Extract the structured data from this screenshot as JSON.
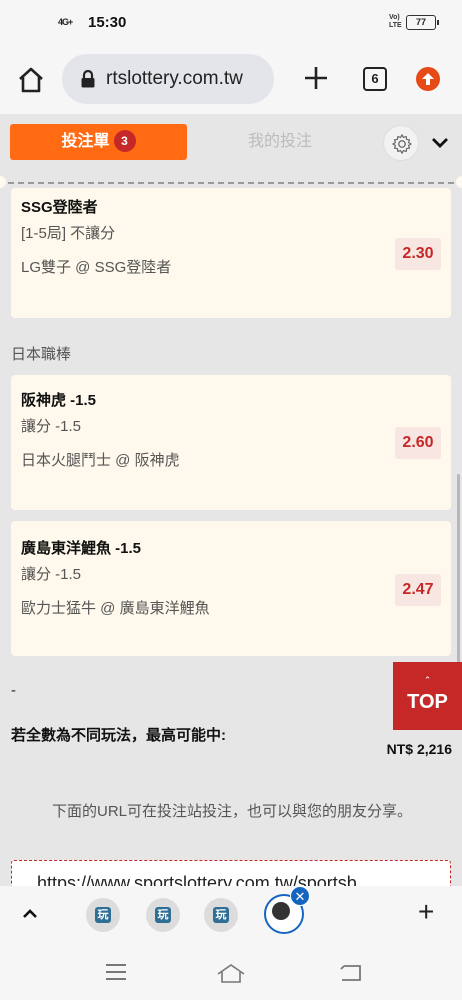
{
  "status_bar": {
    "signal": "4G+",
    "time": "15:30",
    "volte_line1": "Vo)",
    "volte_line2": "LTE",
    "battery": "77"
  },
  "browser": {
    "url": "rtslottery.com.tw",
    "tab_count": "6"
  },
  "slip": {
    "tab_active_label": "投注單",
    "tab_active_count": "3",
    "tab_inactive_label": "我的投注"
  },
  "bets": [
    {
      "title": "SSG登陸者",
      "market": "[1-5局] 不讓分",
      "match": "LG雙子 @ SSG登陸者",
      "odds": "2.30"
    },
    {
      "title": "阪神虎 -1.5",
      "market": "讓分 -1.5",
      "match": "日本火腿鬥士 @ 阪神虎",
      "odds": "2.60"
    },
    {
      "title": "廣島東洋鯉魚 -1.5",
      "market": "讓分 -1.5",
      "match": "歐力士猛牛 @ 廣島東洋鯉魚",
      "odds": "2.47"
    }
  ],
  "league_label": "日本職棒",
  "summary": {
    "dash": "-",
    "max_win_label": "若全數為不同玩法，最高可能中:",
    "max_win_amount": "NT$ 2,216"
  },
  "top_button": {
    "arrow": "⌃",
    "label": "TOP"
  },
  "share": {
    "text": "下面的URL可在投注站投注，也可以與您的朋友分享。",
    "url_partial": "https://www.sportslottery.com.tw/sportsb"
  },
  "tab_group": {
    "favicon_label": "玩",
    "close_symbol": "✕",
    "add_symbol": "+"
  },
  "colors": {
    "accent": "#ff6a13",
    "odds_red": "#c62828",
    "card_bg": "#fef9ec",
    "page_bg": "#e6e6e6"
  }
}
